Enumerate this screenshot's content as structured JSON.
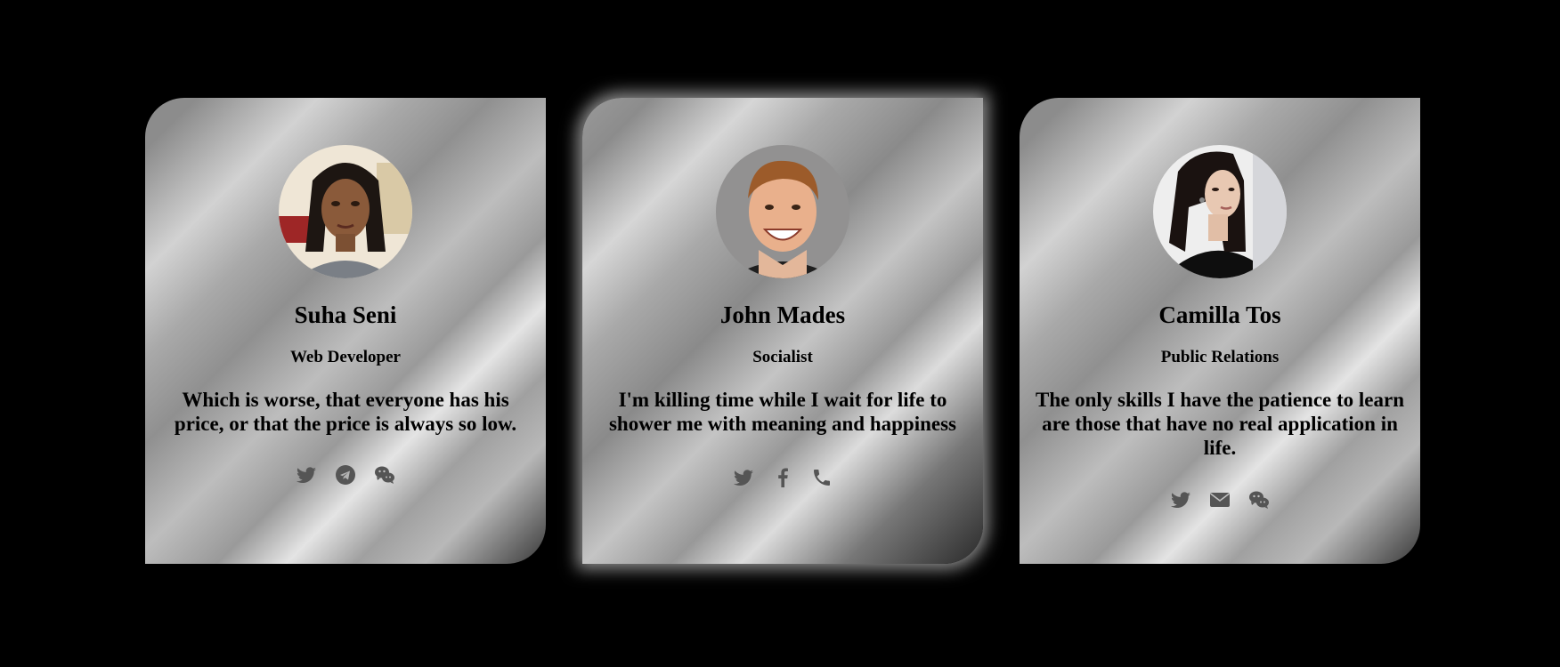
{
  "cards": [
    {
      "name": "Suha Seni",
      "role": "Web Developer",
      "quote": "Which is worse, that everyone has his price, or that the price is always so low.",
      "avatar": "portrait-photo",
      "socials": [
        "twitter-icon",
        "telegram-icon",
        "wechat-icon"
      ]
    },
    {
      "name": "John Mades",
      "role": "Socialist",
      "quote": "I'm killing time while I wait for life to shower me with meaning and happiness",
      "avatar": "portrait-photo",
      "socials": [
        "twitter-icon",
        "facebook-icon",
        "phone-icon"
      ]
    },
    {
      "name": "Camilla Tos",
      "role": "Public Relations",
      "quote": "The only skills I have the patience to learn are those that have no real application in life.",
      "avatar": "portrait-photo",
      "socials": [
        "twitter-icon",
        "envelope-icon",
        "wechat-icon"
      ]
    }
  ],
  "colors": {
    "page_background": "#000000",
    "icon_color": "#555555",
    "highlight_glow": "#ffffff"
  }
}
